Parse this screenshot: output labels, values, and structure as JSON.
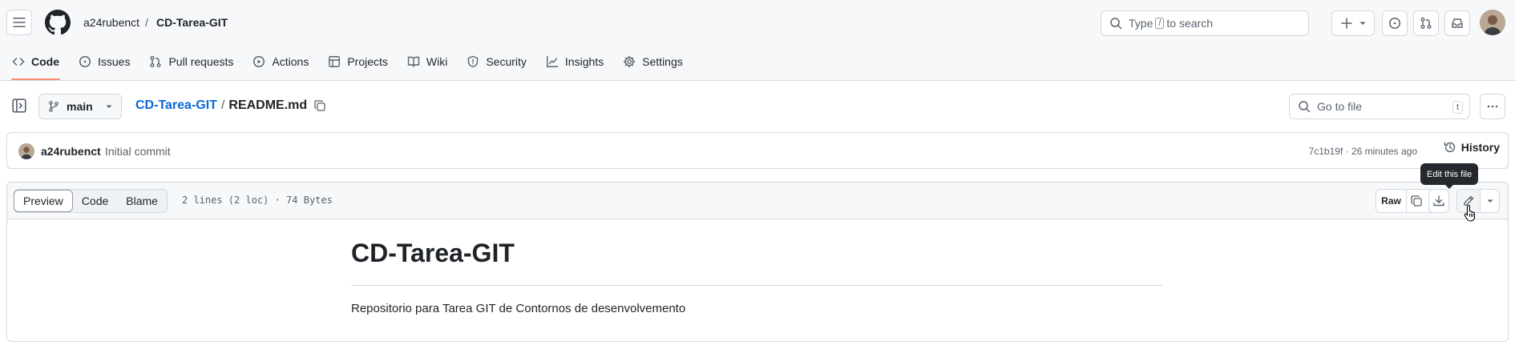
{
  "header": {
    "owner": "a24rubenct",
    "separator": "/",
    "repo": "CD-Tarea-GIT",
    "search_prefix": "Type",
    "search_key": "/",
    "search_suffix": "to search"
  },
  "repo_nav": [
    {
      "label": "Code",
      "icon": "code-icon"
    },
    {
      "label": "Issues",
      "icon": "issue-icon"
    },
    {
      "label": "Pull requests",
      "icon": "pull-request-icon"
    },
    {
      "label": "Actions",
      "icon": "play-icon"
    },
    {
      "label": "Projects",
      "icon": "table-icon"
    },
    {
      "label": "Wiki",
      "icon": "book-icon"
    },
    {
      "label": "Security",
      "icon": "shield-icon"
    },
    {
      "label": "Insights",
      "icon": "graph-icon"
    },
    {
      "label": "Settings",
      "icon": "gear-icon"
    }
  ],
  "file_toolbar": {
    "branch": "main",
    "repo_link": "CD-Tarea-GIT",
    "path_sep": "/",
    "file_name": "README.md",
    "goto_placeholder": "Go to file",
    "goto_key": "t"
  },
  "commit": {
    "author": "a24rubenct",
    "message": "Initial commit",
    "meta": "7c1b19f · 26 minutes ago",
    "history_label": "History"
  },
  "tooltip": "Edit this file",
  "file_view": {
    "tabs": [
      "Preview",
      "Code",
      "Blame"
    ],
    "active_tab": "Preview",
    "info": "2 lines (2 loc) · 74 Bytes",
    "raw_label": "Raw"
  },
  "readme": {
    "heading": "CD-Tarea-GIT",
    "paragraph": "Repositorio para Tarea GIT de Contornos de desenvolvemento"
  },
  "colors": {
    "accent_link": "#0969da",
    "tab_underline": "#fd8c73",
    "tooltip_bg": "#25292e"
  }
}
